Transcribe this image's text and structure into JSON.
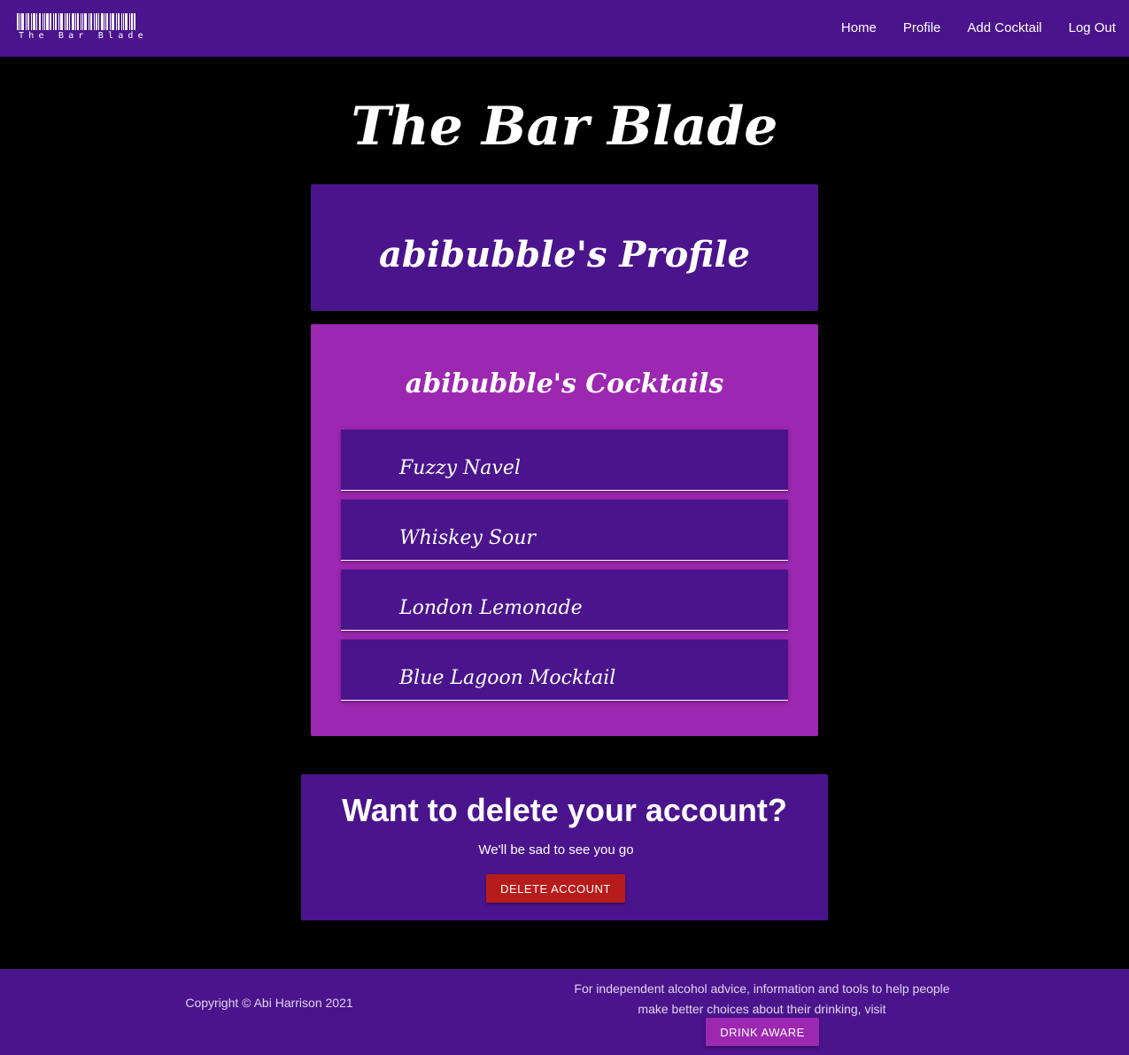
{
  "navbar": {
    "brand_text": "The Bar Blade",
    "brand_icon": "barcode-icon",
    "links": [
      {
        "label": "Home"
      },
      {
        "label": "Profile"
      },
      {
        "label": "Add Cocktail"
      },
      {
        "label": "Log Out"
      }
    ]
  },
  "main": {
    "site_title": "The Bar Blade",
    "profile": {
      "heading": "abibubble's Profile"
    },
    "cocktails": {
      "heading": "abibubble's Cocktails",
      "items": [
        {
          "name": "Fuzzy Navel"
        },
        {
          "name": "Whiskey Sour"
        },
        {
          "name": "London Lemonade"
        },
        {
          "name": "Blue Lagoon Mocktail"
        }
      ]
    },
    "delete_account": {
      "heading": "Want to delete your account?",
      "subtext": "We'll be sad to see you go",
      "button_label": "Delete Account"
    }
  },
  "footer": {
    "copyright": "Copyright © Abi Harrison 2021",
    "advice": "For independent alcohol advice, information and tools to help people make better choices about their drinking, visit",
    "button_label": "Drink Aware"
  },
  "colors": {
    "primary": "#4a148c",
    "accent": "#9c27b0",
    "danger": "#b71c1c",
    "background": "#000000"
  }
}
